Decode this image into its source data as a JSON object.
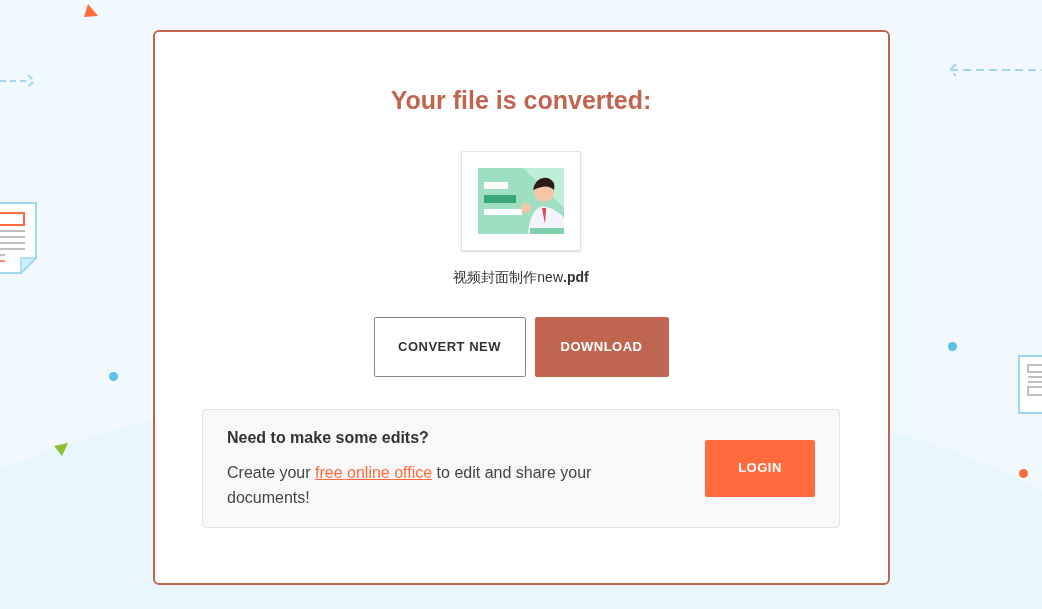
{
  "title": "Your file is converted:",
  "file": {
    "kind": "picture",
    "name": "视频封面制作new**.pdf**"
  },
  "buttons": [
    {
      "label": "CONVERT NEW",
      "kind": "outline"
    },
    {
      "label": "DOWNLOAD",
      "kind": "primary"
    }
  ],
  "edit_panel": {
    "heading": "Need to make some edits?",
    "text_before": "Create your ",
    "link": "free online office",
    "text_after": " to edit and share your documents!",
    "button": "LOGIN"
  }
}
